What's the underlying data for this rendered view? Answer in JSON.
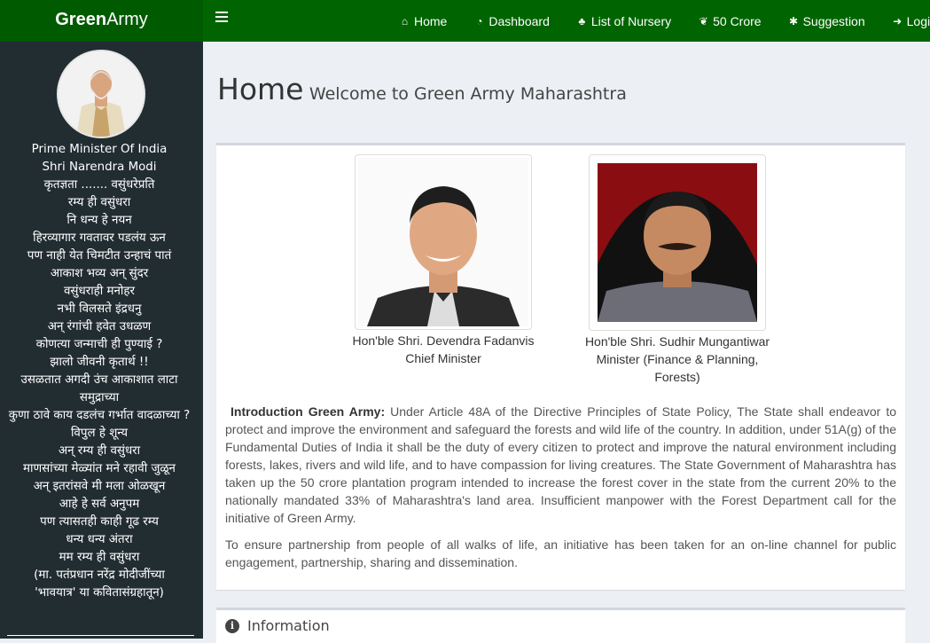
{
  "brand": {
    "bold": "Green",
    "light": "Army"
  },
  "nav": [
    {
      "icon": "home-icon",
      "glyph": "⌂",
      "label": "Home"
    },
    {
      "icon": "dashboard-icon",
      "glyph": "◔",
      "label": "Dashboard"
    },
    {
      "icon": "tree-icon",
      "glyph": "♣",
      "label": "List of Nursery"
    },
    {
      "icon": "leaf-icon",
      "glyph": "❦",
      "label": "50 Crore"
    },
    {
      "icon": "gear-icon",
      "glyph": "✱",
      "label": "Suggestion"
    },
    {
      "icon": "login-icon",
      "glyph": "➜",
      "label": "Login"
    }
  ],
  "sidebar": {
    "poem": [
      "Prime Minister Of India",
      "Shri Narendra Modi",
      "कृतज्ञता ....... वसुंधरेप्रति",
      "रम्य ही वसुंधरा",
      "नि धन्य हे नयन",
      "हिरव्यागार गवतावर पडलंय ऊन",
      "पण नाही येत चिमटीत उन्हाचं पातं",
      "आकाश भव्य अन् सुंदर",
      "वसुंधराही मनोहर",
      "नभी विलसते इंद्रधनु",
      "अन् रंगांची हवेत उधळण",
      "कोणत्या जन्माची ही पुण्याई ?",
      "झालो जीवनी कृतार्थ !!",
      "उसळतात अगदी उंच आकाशात लाटा समुद्राच्या",
      "कुणा ठावे काय दडलंच गर्भात वादळाच्या ?",
      "विपुल हे शून्य",
      "अन् रम्य ही वसुंधरा",
      "माणसांच्या मेळ्यांत मने रहावी जुळून",
      "अन् इतरांसवे मी मला ओळखून",
      "आहे हे सर्व अनुपम",
      "पण त्यासतही काही गूढ रम्य",
      "धन्य धन्य अंतरा",
      "मम रम्य ही वसुंधरा",
      "(मा. पतंप्रधान नरेंद्र मोदीजींच्या",
      "'भावयात्र' या कवितासंग्रहातून)"
    ]
  },
  "page": {
    "title": "Home",
    "subtitle": "Welcome to Green Army Maharashtra"
  },
  "leaders": [
    {
      "name": "Hon'ble Shri. Devendra Fadanvis",
      "role": "Chief Minister"
    },
    {
      "name": "Hon'ble Shri. Sudhir Mungantiwar",
      "role": "Minister (Finance & Planning, Forests)"
    }
  ],
  "intro": {
    "heading": "Introduction Green Army:",
    "body": " Under Article 48A of the Directive Principles of State Policy, The State shall endeavor to protect and improve the environment and safeguard the forests and wild life of the country. In addition, under 51A(g) of the Fundamental Duties of India it shall be the duty of every citizen to protect and improve the natural environment including forests, lakes, rivers and wild life, and to have compassion for living creatures. The State Government of Maharashtra has taken up the 50 crore plantation program intended to increase the forest cover in the state from the current 20% to the nationally mandated 33% of Maharashtra's land area. Insufficient manpower with the Forest Department call for the initiative of Green Army.",
    "para2": "To ensure partnership from people of all walks of life, an initiative has been taken for an on-line channel for public engagement, partnership, sharing and dissemination."
  },
  "info": {
    "title": "Information"
  },
  "colors": {
    "topbar": "#006400",
    "sidebar": "#222d32",
    "content_bg": "#ecf0f5"
  }
}
